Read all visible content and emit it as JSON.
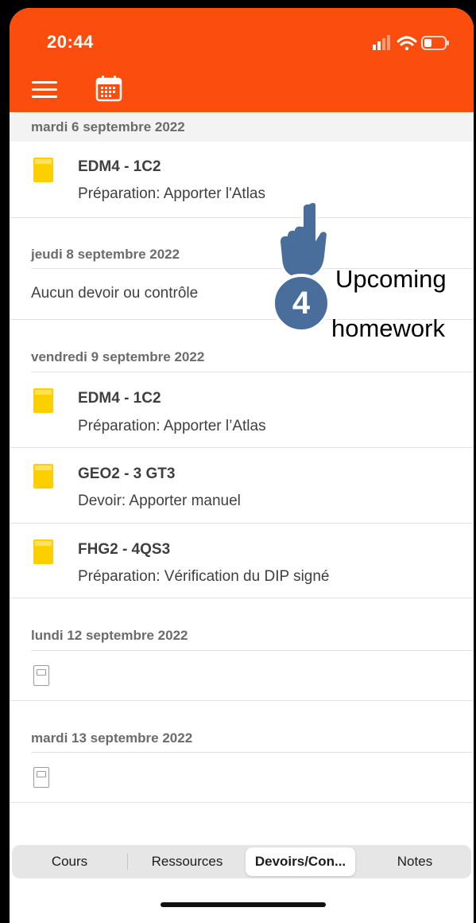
{
  "status_bar": {
    "time": "20:44"
  },
  "days": [
    {
      "date": "mardi 6 septembre 2022",
      "items": [
        {
          "course": "EDM4 - 1C2",
          "desc": "Préparation: Apporter l'Atlas"
        }
      ]
    },
    {
      "date": "jeudi 8 septembre 2022",
      "empty_text": "Aucun devoir ou contrôle"
    },
    {
      "date": "vendredi 9 septembre 2022",
      "items": [
        {
          "course": "EDM4 - 1C2",
          "desc": "Préparation: Apporter l’Atlas"
        },
        {
          "course": "GEO2 - 3 GT3",
          "desc": "Devoir: Apporter manuel"
        },
        {
          "course": "FHG2 - 4QS3",
          "desc": "Préparation: Vérification du DIP signé"
        }
      ]
    },
    {
      "date": "lundi 12 septembre 2022"
    },
    {
      "date": "mardi 13 septembre 2022"
    }
  ],
  "tabs": [
    "Cours",
    "Ressources",
    "Devoirs/Con...",
    "Notes"
  ],
  "active_tab": "Devoirs/Con...",
  "annotation": {
    "number": "4",
    "line1": "Upcoming",
    "line2": "homework"
  },
  "colors": {
    "header": "#fb4e0e",
    "book": "#fcd000",
    "badge": "#4a6e9c"
  },
  "icons": [
    "menu-icon",
    "calendar-icon",
    "book-icon",
    "empty-book-icon",
    "hand-pointer-icon"
  ]
}
